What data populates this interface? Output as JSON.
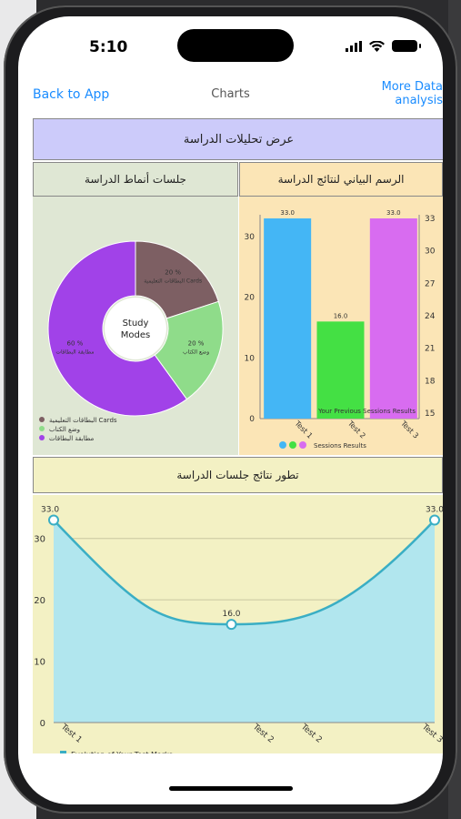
{
  "status": {
    "time": "5:10"
  },
  "nav": {
    "back": "Back to App",
    "title": "Charts",
    "more_line1": "More Data",
    "more_line2": "analysis"
  },
  "header": {
    "title": "عرض تحليلات الدراسة"
  },
  "sections": {
    "left_title": "جلسات أنماط الدراسة",
    "right_title": "الرسم البياني لنتائج الدراسة",
    "bottom_title": "تطور نتائج جلسات الدراسة"
  },
  "colors": {
    "link": "#1a8cff",
    "header_bg": "#cccbfa",
    "pie_bg": "#dfe7d4",
    "bar_bg": "#fbe5b6",
    "line_bg": "#f3f1c4"
  },
  "chart_data": [
    {
      "type": "pie",
      "center_label_1": "Study",
      "center_label_2": "Modes",
      "slices": [
        {
          "label": "البطاقات التعليمية Cards",
          "value": 20,
          "text": "20 %",
          "color": "#7d5f63"
        },
        {
          "label": "وضع الكتاب",
          "value": 20,
          "text": "20 %",
          "color": "#8fdc8a"
        },
        {
          "label": "مطابقة البطاقات",
          "value": 60,
          "text": "60 %",
          "color": "#a142e8"
        }
      ]
    },
    {
      "type": "bar",
      "categories": [
        "Test 1",
        "Test 2",
        "Test 3"
      ],
      "values": [
        33.0,
        16.0,
        33.0
      ],
      "value_labels": [
        "33.0",
        "16.0",
        "33.0"
      ],
      "colors": [
        "#44b6f5",
        "#44e044",
        "#d86cf0"
      ],
      "ylim": [
        0,
        33
      ],
      "left_ticks": [
        "0",
        "10",
        "20",
        "30"
      ],
      "right_ticks": [
        "15",
        "18",
        "21",
        "24",
        "27",
        "30",
        "33"
      ],
      "overlay_text": "Your Previous Sessions Results",
      "legend": "Sessions Results"
    },
    {
      "type": "line",
      "categories": [
        "Test 1",
        "Test 2",
        "Test 2",
        "Test 3"
      ],
      "points": [
        {
          "x": "Test 1",
          "y": 33.0,
          "label": "33.0"
        },
        {
          "x": "Test 2",
          "y": 16.0,
          "label": "16.0"
        },
        {
          "x": "Test 3",
          "y": 33.0,
          "label": "33.0"
        }
      ],
      "ylim": [
        0,
        35
      ],
      "y_ticks": [
        "0",
        "10",
        "20",
        "30"
      ],
      "legend": "Evolution of Your Test Marks",
      "color": "#3aaec4"
    }
  ]
}
